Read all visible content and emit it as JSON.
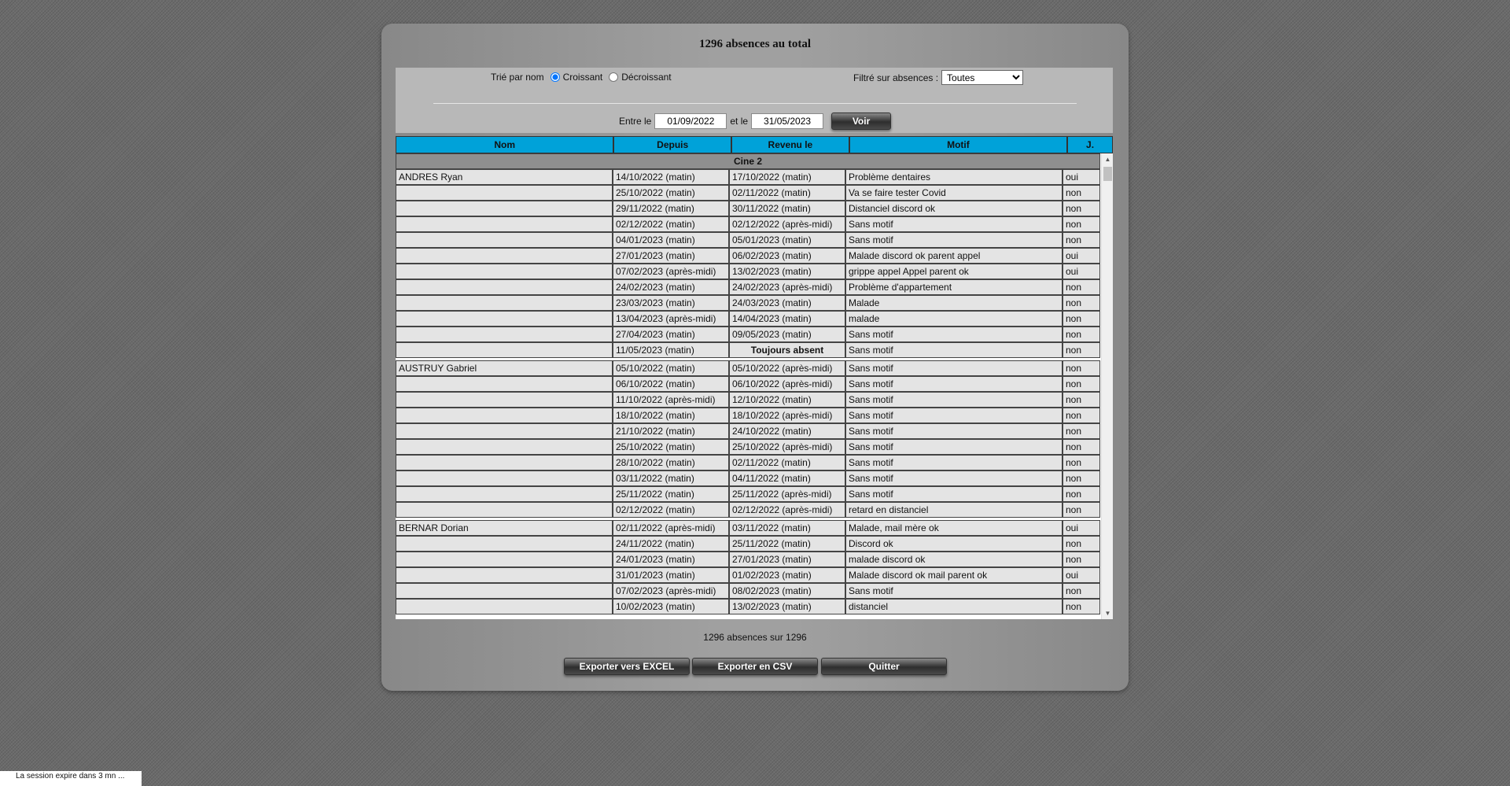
{
  "title": "1296 absences au total",
  "sort": {
    "label": "Trié par nom",
    "asc": "Croissant",
    "desc": "Décroissant"
  },
  "filter": {
    "label": "Filtré sur absences :",
    "selected": "Toutes"
  },
  "dates": {
    "from_label": "Entre le",
    "from": "01/09/2022",
    "to_label": "et le",
    "to": "31/05/2023",
    "button": "Voir"
  },
  "columns": [
    "Nom",
    "Depuis",
    "Revenu le",
    "Motif",
    "J."
  ],
  "group": "Cine 2",
  "students": [
    {
      "name": "ANDRES Ryan",
      "rows": [
        [
          "14/10/2022 (matin)",
          "17/10/2022 (matin)",
          "Problème dentaires",
          "oui"
        ],
        [
          "25/10/2022 (matin)",
          "02/11/2022 (matin)",
          "Va se faire tester Covid",
          "non"
        ],
        [
          "29/11/2022 (matin)",
          "30/11/2022 (matin)",
          "Distanciel discord ok",
          "non"
        ],
        [
          "02/12/2022 (matin)",
          "02/12/2022 (après-midi)",
          "Sans motif",
          "non"
        ],
        [
          "04/01/2023 (matin)",
          "05/01/2023 (matin)",
          "Sans motif",
          "non"
        ],
        [
          "27/01/2023 (matin)",
          "06/02/2023 (matin)",
          "Malade discord ok parent appel",
          "oui"
        ],
        [
          "07/02/2023 (après-midi)",
          "13/02/2023 (matin)",
          "grippe appel Appel parent ok",
          "oui"
        ],
        [
          "24/02/2023 (matin)",
          "24/02/2023 (après-midi)",
          "Problème d'appartement",
          "non"
        ],
        [
          "23/03/2023 (matin)",
          "24/03/2023 (matin)",
          "Malade",
          "non"
        ],
        [
          "13/04/2023 (après-midi)",
          "14/04/2023 (matin)",
          "malade",
          "non"
        ],
        [
          "27/04/2023 (matin)",
          "09/05/2023 (matin)",
          "Sans motif",
          "non"
        ],
        [
          "11/05/2023 (matin)",
          "Toujours absent",
          "Sans motif",
          "non"
        ]
      ]
    },
    {
      "name": "AUSTRUY Gabriel",
      "rows": [
        [
          "05/10/2022 (matin)",
          "05/10/2022 (après-midi)",
          "Sans motif",
          "non"
        ],
        [
          "06/10/2022 (matin)",
          "06/10/2022 (après-midi)",
          "Sans motif",
          "non"
        ],
        [
          "11/10/2022 (après-midi)",
          "12/10/2022 (matin)",
          "Sans motif",
          "non"
        ],
        [
          "18/10/2022 (matin)",
          "18/10/2022 (après-midi)",
          "Sans motif",
          "non"
        ],
        [
          "21/10/2022 (matin)",
          "24/10/2022 (matin)",
          "Sans motif",
          "non"
        ],
        [
          "25/10/2022 (matin)",
          "25/10/2022 (après-midi)",
          "Sans motif",
          "non"
        ],
        [
          "28/10/2022 (matin)",
          "02/11/2022 (matin)",
          "Sans motif",
          "non"
        ],
        [
          "03/11/2022 (matin)",
          "04/11/2022 (matin)",
          "Sans motif",
          "non"
        ],
        [
          "25/11/2022 (matin)",
          "25/11/2022 (après-midi)",
          "Sans motif",
          "non"
        ],
        [
          "02/12/2022 (matin)",
          "02/12/2022 (après-midi)",
          "retard en distanciel",
          "non"
        ]
      ]
    },
    {
      "name": "BERNAR Dorian",
      "rows": [
        [
          "02/11/2022 (après-midi)",
          "03/11/2022 (matin)",
          "Malade, mail mère ok",
          "oui"
        ],
        [
          "24/11/2022 (matin)",
          "25/11/2022 (matin)",
          "Discord ok",
          "non"
        ],
        [
          "24/01/2023 (matin)",
          "27/01/2023 (matin)",
          "malade discord ok",
          "non"
        ],
        [
          "31/01/2023 (matin)",
          "01/02/2023 (matin)",
          "Malade discord ok mail parent ok",
          "oui"
        ],
        [
          "07/02/2023 (après-midi)",
          "08/02/2023 (matin)",
          "Sans motif",
          "non"
        ],
        [
          "10/02/2023 (matin)",
          "13/02/2023 (matin)",
          "distanciel",
          "non"
        ]
      ]
    }
  ],
  "count_text": "1296 absences sur 1296",
  "buttons": {
    "excel": "Exporter vers EXCEL",
    "csv": "Exporter en CSV",
    "quit": "Quitter"
  },
  "session_text": "La session expire dans 3 mn ..."
}
